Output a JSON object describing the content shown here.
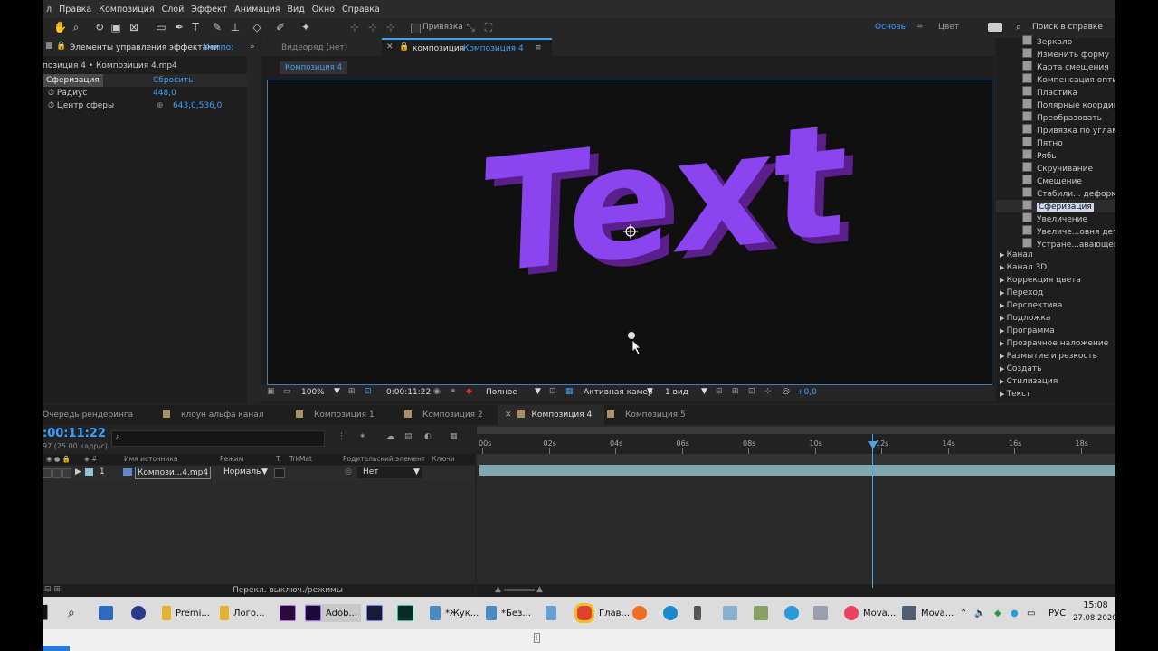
{
  "menu": [
    "л",
    "Правка",
    "Композиция",
    "Слой",
    "Эффект",
    "Анимация",
    "Вид",
    "Окно",
    "Справка"
  ],
  "toolbar": {
    "snap_label": "Привязка",
    "workspace_main": "Основы",
    "workspace_color": "Цвет",
    "help_search": "Поиск в справке"
  },
  "effects_controls": {
    "tab_label": "Элементы управления эффектами",
    "tab_comp": "Компо:",
    "breadcrumb": "позиция 4 • Композиция 4.mp4",
    "effect_name": "Сферизация",
    "reset_label": "Сбросить",
    "params": [
      {
        "label": "Радиус",
        "value": "448,0"
      },
      {
        "label": "Центр сферы",
        "value": "643,0,536,0"
      }
    ]
  },
  "viewer": {
    "tab_footage": "Видеоряд (нет)",
    "tab_comp_prefix": "композиция",
    "tab_comp_name": "Композиция 4",
    "comp_chip": "Композиция 4",
    "canvas_text": "Text",
    "zoom": "100%",
    "timecode": "0:00:11:22",
    "resolution": "Полное",
    "camera": "Активная камер",
    "views": "1 вид",
    "exposure": "+0,0"
  },
  "effects_list": {
    "items": [
      "Зеркало",
      "Изменить форму",
      "Карта смещения",
      "Компенсация оптики",
      "Пластика",
      "Полярные координаты",
      "Преобразовать",
      "Привязка по углам",
      "Пятно",
      "Рябь",
      "Скручивание",
      "Смещение",
      "Стабили... деформации",
      "Сферизация",
      "Увеличение",
      "Увеличе...овня детализации",
      "Устране...авающего затвора"
    ],
    "selected": "Сферизация",
    "categories": [
      "Канал",
      "Канал 3D",
      "Коррекция цвета",
      "Переход",
      "Перспектива",
      "Подложка",
      "Программа",
      "Прозрачное наложение",
      "Размытие и резкость",
      "Создать",
      "Стилизация",
      "Текст"
    ]
  },
  "timeline": {
    "tabs": [
      {
        "label": "Очередь рендеринга"
      },
      {
        "label": "клоун альфа канал"
      },
      {
        "label": "Композиция 1"
      },
      {
        "label": "Композиция 2"
      },
      {
        "label": "Композиция 4",
        "active": true
      },
      {
        "label": "Композиция 5"
      }
    ],
    "timecode": ":00:11:22",
    "fps": "97 (25.00 кадр/с)",
    "columns": [
      "Имя источника",
      "Режим",
      "T",
      "TrkMat",
      "Родительский элемент",
      "Ключи"
    ],
    "layer": {
      "index": "1",
      "name": "Компози...4.mp4",
      "mode": "Нормаль",
      "parent": "Нет"
    },
    "ruler": [
      "00s",
      "02s",
      "04s",
      "06s",
      "08s",
      "10s",
      "12s",
      "14s",
      "16s",
      "18s"
    ],
    "footer": "Перекл. выключ./режимы"
  },
  "taskbar": {
    "apps": [
      "Premi...",
      "Лого...",
      "Adob...",
      "*Жук...",
      "*Без...",
      "Глав...",
      "Mova...",
      "Mova..."
    ],
    "lang": "РУС",
    "time": "15:08",
    "date": "27.08.2020"
  },
  "colors": {
    "accent": "#3ca0ff",
    "text_purple": "#8a44f0",
    "playhead": "#4aa6e8"
  }
}
